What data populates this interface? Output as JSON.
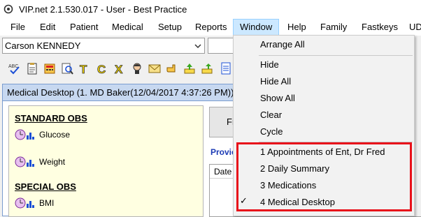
{
  "window": {
    "title": "VIP.net 2.1.530.017 - User - Best Practice"
  },
  "menubar": {
    "items": [
      "File",
      "Edit",
      "Patient",
      "Medical",
      "Setup",
      "Reports",
      "Window",
      "Help",
      "Family",
      "Fastkeys",
      "UD"
    ],
    "active": "Window"
  },
  "patient": {
    "selected": "Carson KENNEDY"
  },
  "toolbar": {
    "icons": [
      "spellcheck-icon",
      "clipboard-icon",
      "calculator-icon",
      "magnify-document-icon",
      "t-letter-icon",
      "c-letter-icon",
      "x-letter-icon",
      "person-head-icon",
      "envelope-icon",
      "hand-pointer-icon",
      "inbox-arrow-icon",
      "tray-arrow-icon",
      "document-icon"
    ]
  },
  "doc": {
    "title": "Medical Desktop (1. MD Baker(12/04/2017 4:37:26 PM))",
    "sections": [
      {
        "heading": "STANDARD OBS",
        "items": [
          "Glucose",
          "Weight"
        ]
      },
      {
        "heading": "SPECIAL OBS",
        "items": [
          "BMI"
        ]
      }
    ],
    "button_left": "Fr",
    "button_right": "ca",
    "provider_label": "Provic",
    "grid_headers": [
      "Date",
      "ro"
    ]
  },
  "window_menu": {
    "items": [
      "Arrange All",
      "Hide",
      "Hide All",
      "Show All",
      "Clear",
      "Cycle"
    ],
    "windows": [
      "1 Appointments of Ent, Dr Fred",
      "2 Daily Summary",
      "3 Medications",
      "4 Medical Desktop"
    ],
    "checked": "4 Medical Desktop"
  },
  "colors": {
    "menu_active_bg": "#cce8ff",
    "doc_title_bg": "#c7d8f0",
    "left_pane_bg": "#ffffe1",
    "highlight": "#e8101a",
    "provider_text": "#1c3bb5"
  }
}
